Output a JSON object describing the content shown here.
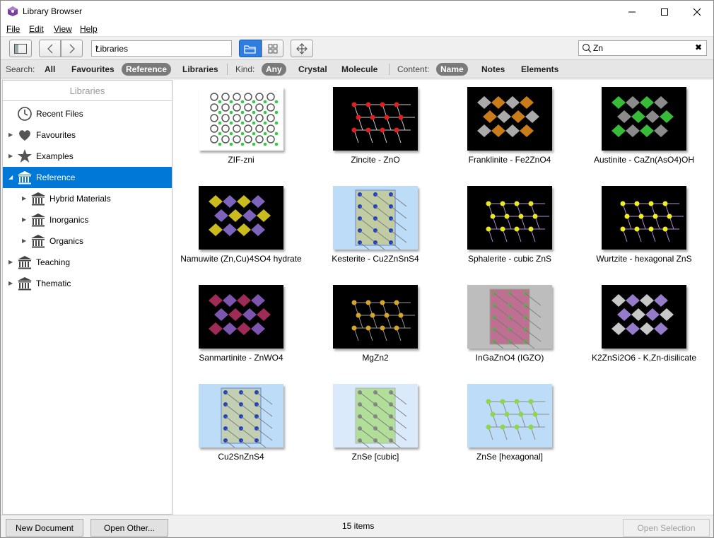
{
  "window": {
    "title": "Library Browser"
  },
  "menu": [
    "File",
    "Edit",
    "View",
    "Help"
  ],
  "toolbar": {
    "location": "Libraries",
    "search_value": "Zn"
  },
  "filters": {
    "search_label": "Search:",
    "search_options": [
      "All",
      "Favourites",
      "Reference",
      "Libraries"
    ],
    "search_selected": "Reference",
    "kind_label": "Kind:",
    "kind_options": [
      "Any",
      "Crystal",
      "Molecule"
    ],
    "kind_selected": "Any",
    "content_label": "Content:",
    "content_options": [
      "Name",
      "Notes",
      "Elements"
    ],
    "content_selected": "Name"
  },
  "sidebar": {
    "header": "Libraries",
    "items": [
      {
        "label": "Recent Files",
        "icon": "clock-icon",
        "level": 0,
        "expander": false
      },
      {
        "label": "Favourites",
        "icon": "heart-icon",
        "level": 0,
        "expander": true
      },
      {
        "label": "Examples",
        "icon": "star-icon",
        "level": 0,
        "expander": true
      },
      {
        "label": "Reference",
        "icon": "library-icon",
        "level": 0,
        "expander": true,
        "expanded": true,
        "selected": true
      },
      {
        "label": "Hybrid Materials",
        "icon": "library-icon",
        "level": 1,
        "expander": true
      },
      {
        "label": "Inorganics",
        "icon": "library-icon",
        "level": 1,
        "expander": true
      },
      {
        "label": "Organics",
        "icon": "library-icon",
        "level": 1,
        "expander": true
      },
      {
        "label": "Teaching",
        "icon": "library-icon",
        "level": 0,
        "expander": true
      },
      {
        "label": "Thematic",
        "icon": "library-icon",
        "level": 0,
        "expander": true
      }
    ]
  },
  "items": [
    {
      "label": "ZIF-zni",
      "bg": "#ffffff",
      "fg": "#2ecc40",
      "accent": "#555555",
      "style": "grid"
    },
    {
      "label": "Zincite - ZnO",
      "bg": "#000000",
      "fg": "#e02020",
      "accent": "#cccccc",
      "style": "lattice"
    },
    {
      "label": "Franklinite - Fe2ZnO4",
      "bg": "#000000",
      "fg": "#e08a1e",
      "accent": "#bdbdbd",
      "style": "poly"
    },
    {
      "label": "Austinite - CaZn(AsO4)OH",
      "bg": "#000000",
      "fg": "#9a9a9a",
      "accent": "#3ecf3e",
      "style": "poly"
    },
    {
      "label": "Namuwite (Zn,Cu)4SO4 hydrate",
      "bg": "#000000",
      "fg": "#8a6fd1",
      "accent": "#e0d020",
      "style": "poly"
    },
    {
      "label": "Kesterite - Cu2ZnSnS4",
      "bg": "#bcdcf7",
      "fg": "#c7c060",
      "accent": "#1f3fbf",
      "style": "box"
    },
    {
      "label": "Sphalerite - cubic  ZnS",
      "bg": "#000000",
      "fg": "#e8e820",
      "accent": "#b08cd8",
      "style": "lattice"
    },
    {
      "label": "Wurtzite - hexagonal ZnS",
      "bg": "#000000",
      "fg": "#f0f020",
      "accent": "#b08cd8",
      "style": "lattice"
    },
    {
      "label": "Sanmartinite - ZnWO4",
      "bg": "#000000",
      "fg": "#8a5fc1",
      "accent": "#b03060",
      "style": "poly"
    },
    {
      "label": "MgZn2",
      "bg": "#000000",
      "fg": "#d4a52a",
      "accent": "#999999",
      "style": "lattice"
    },
    {
      "label": "InGaZnO4 (IGZO)",
      "bg": "#bdbdbd",
      "fg": "#c03070",
      "accent": "#6fa060",
      "style": "box"
    },
    {
      "label": "K2ZnSi2O6 - K,Zn-disilicate",
      "bg": "#000000",
      "fg": "#a58ae0",
      "accent": "#dddddd",
      "style": "poly"
    },
    {
      "label": "Cu2SnZnS4",
      "bg": "#bcdcf7",
      "fg": "#c9c57a",
      "accent": "#1f3fbf",
      "style": "box"
    },
    {
      "label": "ZnSe [cubic]",
      "bg": "#dbeafa",
      "fg": "#8fd64a",
      "accent": "#888888",
      "style": "box"
    },
    {
      "label": "ZnSe [hexagonal]",
      "bg": "#bcdcf7",
      "fg": "#8fd64a",
      "accent": "#8a8a8a",
      "style": "lattice"
    }
  ],
  "status": {
    "count": "15 items"
  },
  "buttons": {
    "new_document": "New Document",
    "open_other": "Open Other...",
    "open_selection": "Open Selection"
  }
}
